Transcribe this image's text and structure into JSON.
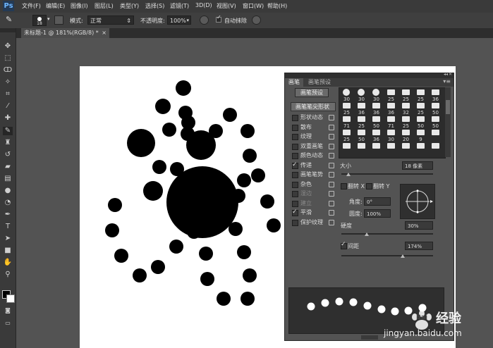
{
  "app": {
    "logo": "Ps"
  },
  "menubar": {
    "items": [
      "文件(F)",
      "编辑(E)",
      "图像(I)",
      "图层(L)",
      "类型(Y)",
      "选择(S)",
      "滤镜(T)",
      "3D(D)",
      "视图(V)",
      "窗口(W)",
      "帮助(H)"
    ]
  },
  "options": {
    "brush_size": "18",
    "mode_label": "模式:",
    "mode_value": "正常",
    "opacity_label": "不透明度:",
    "opacity_value": "100%",
    "auto_erase_label": "自动抹除"
  },
  "document_tab": {
    "title": "未标题-1 @ 181%(RGB/8) *",
    "close": "×"
  },
  "brush_panel": {
    "tabs": [
      "画笔",
      "画笔预设"
    ],
    "preset_button": "画笔预设",
    "shape_header": "画笔笔尖形状",
    "options": [
      {
        "label": "形状动态",
        "checked": false,
        "disabled": false
      },
      {
        "label": "散布",
        "checked": false,
        "disabled": false
      },
      {
        "label": "纹理",
        "checked": false,
        "disabled": false
      },
      {
        "label": "双重画笔",
        "checked": false,
        "disabled": false
      },
      {
        "label": "颜色动态",
        "checked": false,
        "disabled": false
      },
      {
        "label": "传递",
        "checked": true,
        "disabled": false
      },
      {
        "label": "画笔笔势",
        "checked": false,
        "disabled": false
      },
      {
        "label": "杂色",
        "checked": false,
        "disabled": false
      },
      {
        "label": "湿边",
        "checked": false,
        "disabled": true
      },
      {
        "label": "建立",
        "checked": false,
        "disabled": true
      },
      {
        "label": "平滑",
        "checked": true,
        "disabled": false
      },
      {
        "label": "保护纹理",
        "checked": false,
        "disabled": false
      }
    ],
    "tip_sizes": [
      "30",
      "30",
      "30",
      "25",
      "25",
      "25",
      "36",
      "25",
      "36",
      "36",
      "36",
      "32",
      "25",
      "50",
      "71",
      "25",
      "50",
      "71",
      "25",
      "50",
      "50",
      "25",
      "50",
      "36",
      "30",
      "20",
      "9"
    ],
    "size_label": "大小",
    "size_value": "18 像素",
    "flip_x_label": "翻转 X",
    "flip_y_label": "翻转 Y",
    "angle_label": "角度:",
    "angle_value": "0°",
    "roundness_label": "圆度:",
    "roundness_value": "100%",
    "hardness_label": "硬度",
    "hardness_value": "30%",
    "spacing_label": "间距",
    "spacing_value": "174%",
    "spacing_checked": true
  },
  "watermark": {
    "brand": "Bai",
    "cn": "经验",
    "url": "jingyan.baidu.com"
  },
  "colors": {
    "bg": "#535353",
    "menubar": "#3a3a3a",
    "canvas": "#ffffff",
    "ink": "#000000"
  }
}
